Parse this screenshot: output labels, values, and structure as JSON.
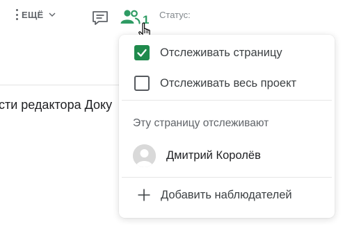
{
  "toolbar": {
    "more_label": "ЕЩЁ",
    "watchers_count": "1",
    "status_label": "Статус:"
  },
  "document": {
    "text_fragment": "сти редактора Доку"
  },
  "watch_menu": {
    "watch_page": {
      "label": "Отслеживать страницу",
      "checked": true
    },
    "watch_project": {
      "label": "Отслеживать весь проект",
      "checked": false
    },
    "watchers_heading": "Эту страницу отслеживают",
    "watchers": [
      {
        "name": "Дмитрий Королёв"
      }
    ],
    "add_watchers_label": "Добавить наблюдателей"
  },
  "colors": {
    "accent_green": "#2e9b63",
    "checkbox_green": "#1f8a4c"
  }
}
